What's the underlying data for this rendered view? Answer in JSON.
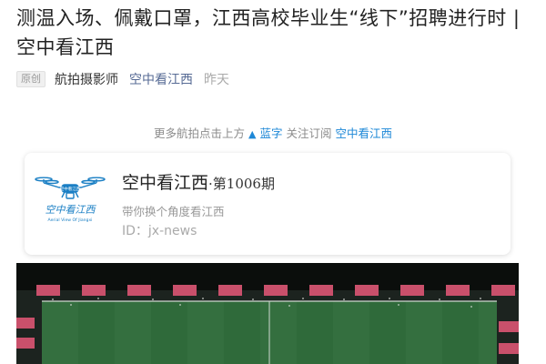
{
  "article": {
    "title": "测温入场、佩戴口罩，江西高校毕业生“线下”招聘进行时 | 空中看江西"
  },
  "meta": {
    "tag": "原创",
    "author": "航拍摄影师",
    "account": "空中看江西",
    "date": "昨天"
  },
  "follow_prompt": {
    "prefix": "更多航拍点击上方",
    "arrow": "▲",
    "blue_word": "蓝字",
    "middle": "关注订阅",
    "account": "空中看江西"
  },
  "card": {
    "name": "空中看江西",
    "issue": "·第1006期",
    "description": "带你换个角度看江西",
    "id_text": "ID：jx-news",
    "logo": {
      "icon": "drone-icon",
      "title_text": "空中看江西",
      "subtitle_text": "Aerial View Of Jiangxi",
      "badge_text": "空中看江西",
      "color": "#1a7fc4"
    }
  },
  "hero_image": {
    "description_icon": "aerial-photo-sports-field",
    "colors": {
      "field": "#2f6a3a",
      "tents": "#c9506b",
      "track": "#1f2a24"
    }
  }
}
